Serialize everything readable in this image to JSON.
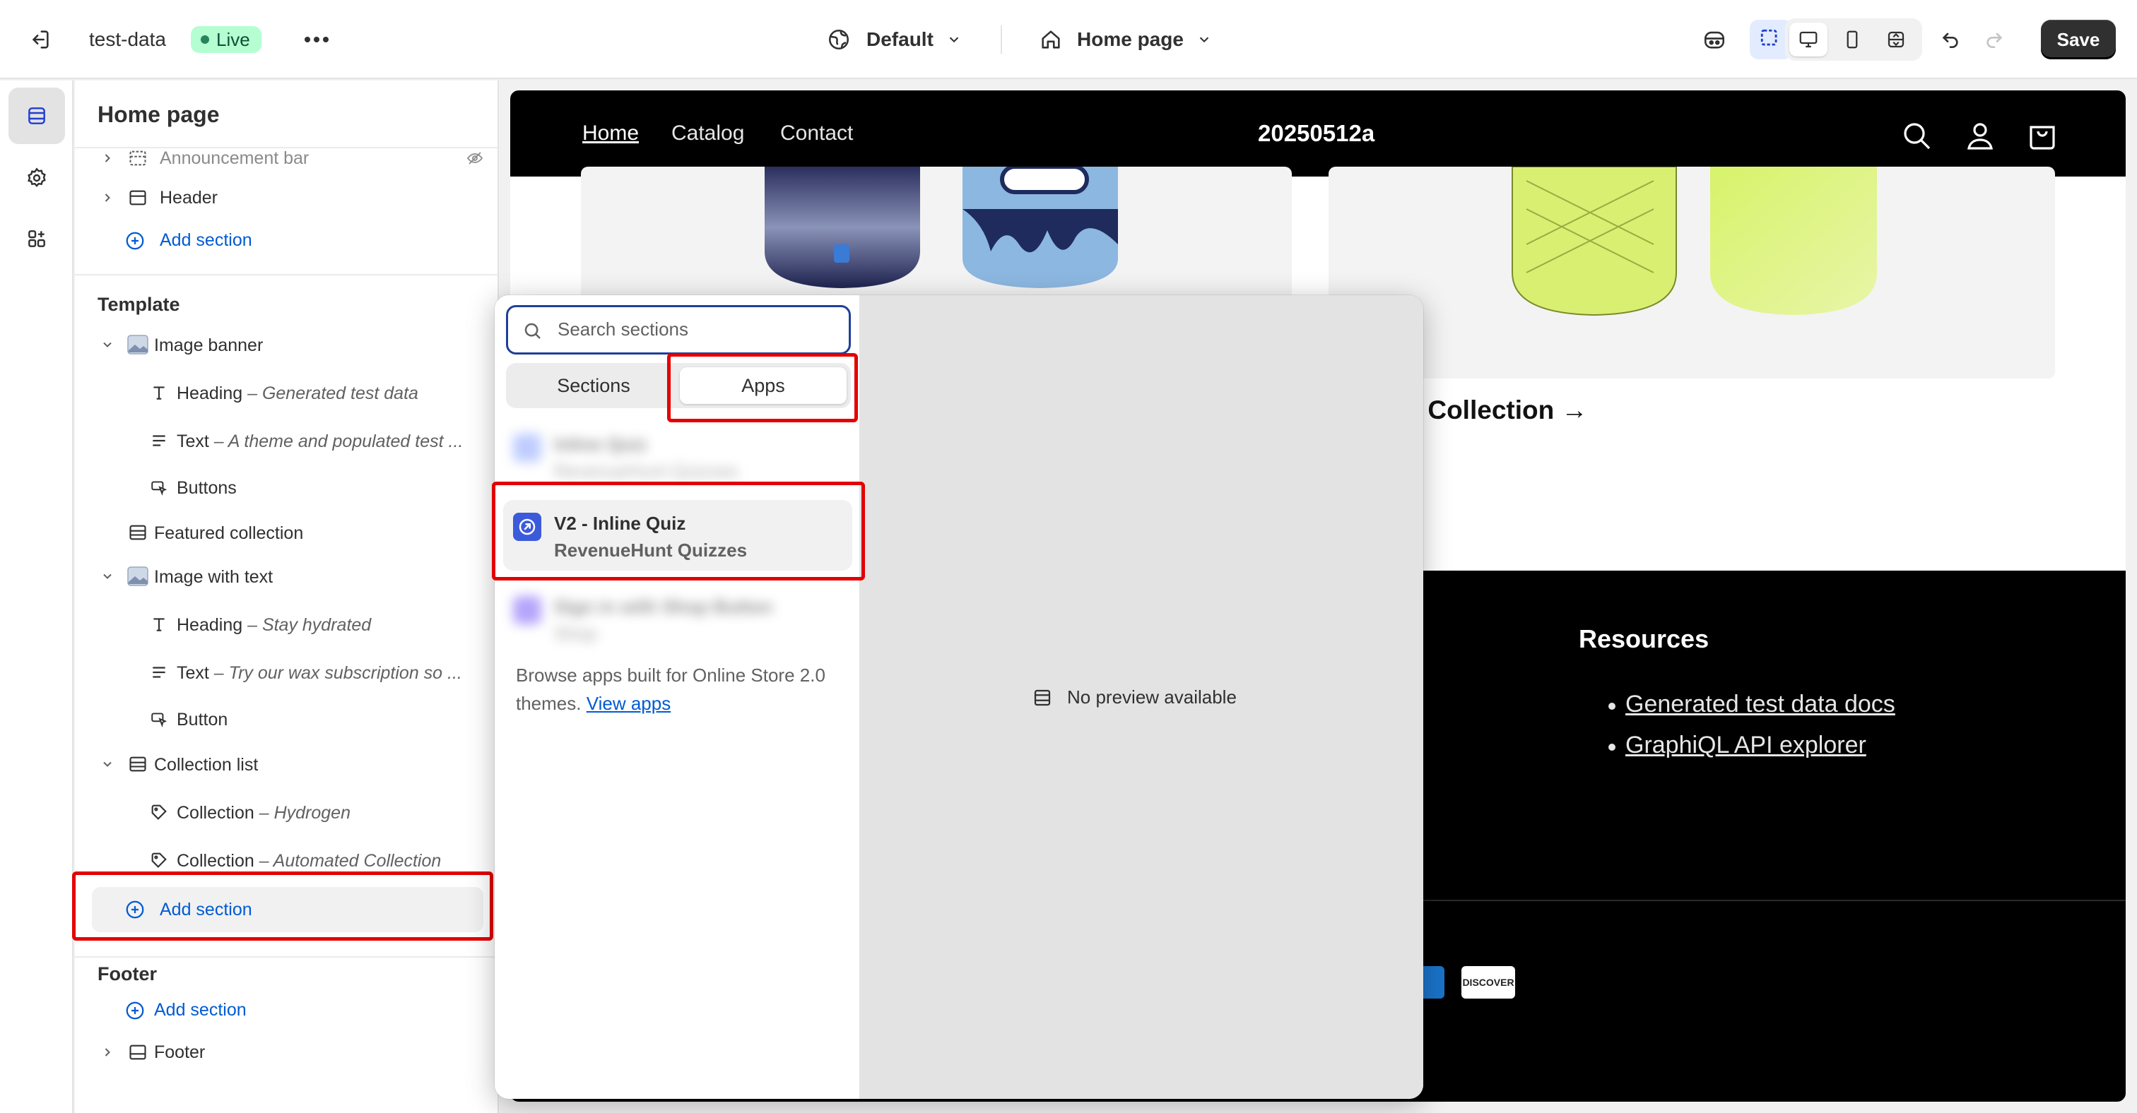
{
  "topbar": {
    "store_name": "test-data",
    "status_badge": "Live",
    "theme_select": "Default",
    "page_select": "Home page",
    "save_label": "Save"
  },
  "sidebar": {
    "title": "Home page",
    "header_group": [
      {
        "label": "Announcement bar",
        "hidden": true
      },
      {
        "label": "Header"
      }
    ],
    "add_section_label": "Add section",
    "template_title": "Template",
    "template_items": [
      {
        "label": "Image banner",
        "kind": "section"
      },
      {
        "label": "Heading",
        "sub": "Generated test data",
        "kind": "block"
      },
      {
        "label": "Text",
        "sub": "A theme and populated test ...",
        "kind": "block"
      },
      {
        "label": "Buttons",
        "kind": "block"
      },
      {
        "label": "Featured collection",
        "kind": "section"
      },
      {
        "label": "Image with text",
        "kind": "section"
      },
      {
        "label": "Heading",
        "sub": "Stay hydrated",
        "kind": "block"
      },
      {
        "label": "Text",
        "sub": "Try our wax subscription so ...",
        "kind": "block"
      },
      {
        "label": "Button",
        "kind": "block"
      },
      {
        "label": "Collection list",
        "kind": "section"
      },
      {
        "label": "Collection",
        "sub": "Hydrogen",
        "kind": "block"
      },
      {
        "label": "Collection",
        "sub": "Automated Collection",
        "kind": "block"
      }
    ],
    "sub_separator": " – ",
    "footer_title": "Footer",
    "footer_item": "Footer"
  },
  "preview": {
    "nav_links": [
      "Home",
      "Catalog",
      "Contact"
    ],
    "brand": "20250512a",
    "collection_title": "ated Collection →",
    "resources_title": "Resources",
    "resource_links": [
      "Generated test data docs",
      "GraphiQL API explorer"
    ],
    "payment_icon": "DISCOVER"
  },
  "popover": {
    "search_placeholder": "Search sections",
    "tabs": [
      "Sections",
      "Apps"
    ],
    "active_tab": "Apps",
    "apps": [
      {
        "title": "Inline Quiz",
        "subtitle": "RevenueHunt Quizzes",
        "blurred": true
      },
      {
        "title": "V2 - Inline Quiz",
        "subtitle": "RevenueHunt Quizzes",
        "blurred": false
      },
      {
        "title": "Sign in with Shop Button",
        "subtitle": "Shop",
        "blurred": true
      }
    ],
    "browse_text": "Browse apps built for Online Store 2.0 themes.",
    "browse_link": "View apps",
    "no_preview": "No preview available"
  },
  "colors": {
    "accent": "#005bd3",
    "highlight_box": "#e30000",
    "live_badge_bg": "#b4fed2"
  }
}
